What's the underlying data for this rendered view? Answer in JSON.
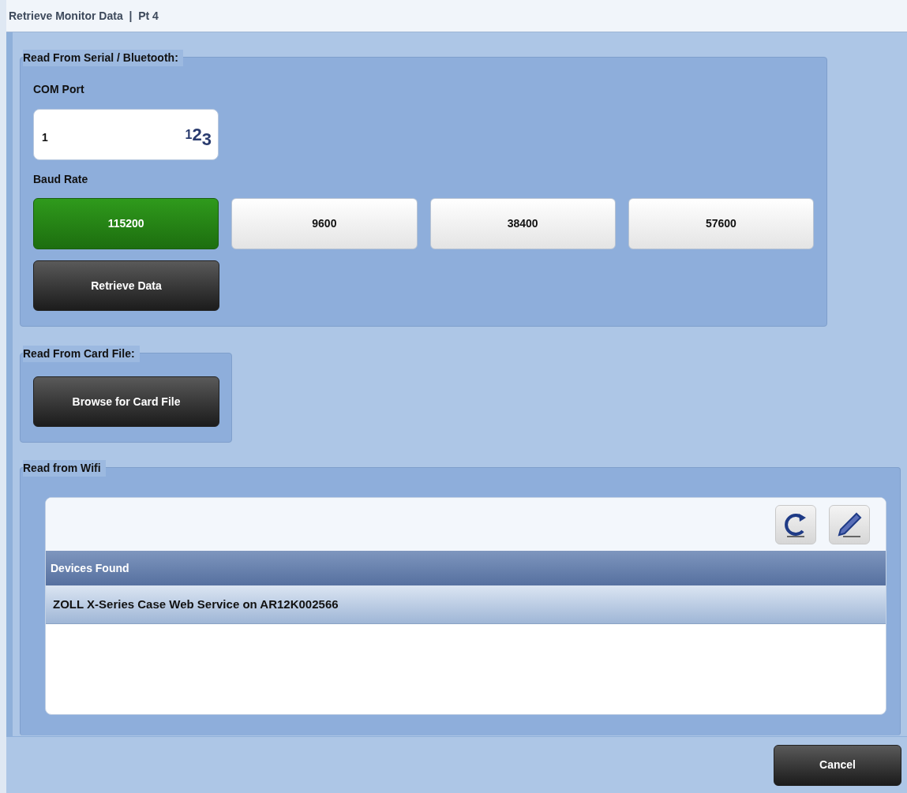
{
  "window": {
    "title": "Retrieve Monitor Data  |  Pt 4"
  },
  "serial": {
    "legend": "Read From Serial / Bluetooth:",
    "com_label": "COM Port",
    "com_value": "1",
    "com_hint": "$^{1}$2$_{3}$",
    "baud_label": "Baud Rate",
    "baud_rates": [
      {
        "label": "115200",
        "selected": true
      },
      {
        "label": "9600",
        "selected": false
      },
      {
        "label": "38400",
        "selected": false
      },
      {
        "label": "57600",
        "selected": false
      }
    ],
    "retrieve_button": "Retrieve Data"
  },
  "card": {
    "legend": "Read From Card File:",
    "browse_button": "Browse for Card File"
  },
  "wifi": {
    "legend": "Read from Wifi",
    "column": "Devices Found",
    "rows": [
      {
        "text": "ZOLL X-Series Case Web Service on AR12K002566",
        "selected": true
      }
    ]
  },
  "buttons": [
    "Cancel"
  ]
}
